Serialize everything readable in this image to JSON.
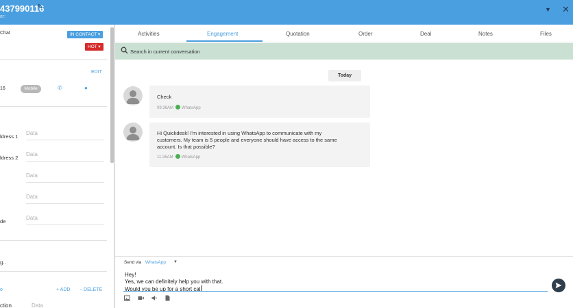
{
  "header": {
    "title": "437990116",
    "subtitle": "er:"
  },
  "left_panel": {
    "chat_label": "Chat",
    "contact_status": "IN CONTACT ▾",
    "temperature": "HOT ▾",
    "edit_label": "EDIT",
    "phone_fragment": "16",
    "phone_type": "Mobile",
    "fields": [
      {
        "label": "ldress 1",
        "value": "Data"
      },
      {
        "label": "ldress 2",
        "value": "Data"
      },
      {
        "label": "",
        "value": "Data"
      },
      {
        "label": "",
        "value": "Data"
      },
      {
        "label": "de",
        "value": "Data"
      }
    ],
    "note": "g..",
    "bottom_link": "o",
    "add_label": "+ ADD",
    "delete_label": "− DELETE",
    "bottom_field_label": "ction",
    "bottom_field_value": "Data"
  },
  "tabs": [
    {
      "label": "Activities",
      "active": false
    },
    {
      "label": "Engagement",
      "active": true
    },
    {
      "label": "Quotation",
      "active": false
    },
    {
      "label": "Order",
      "active": false
    },
    {
      "label": "Deal",
      "active": false
    },
    {
      "label": "Notes",
      "active": false
    },
    {
      "label": "Files",
      "active": false
    }
  ],
  "search": {
    "placeholder": "Search in current conversation"
  },
  "conversation": {
    "date_label": "Today",
    "messages": [
      {
        "lines": [
          "Check"
        ],
        "time": "09:36AM",
        "channel": "WhatsApp"
      },
      {
        "lines": [
          "Hi Quickdesk! I'm interested in using WhatsApp to communicate with my",
          "customers. My team is 5 people and everyone should have access to the same",
          "account. Is that possible?"
        ],
        "time": "11:26AM",
        "channel": "WhatsApp"
      }
    ]
  },
  "composer": {
    "send_via_label": "Send via",
    "channel": "WhatsApp",
    "draft_lines": [
      "Hey!",
      "Yes, we can definitely help you with that.",
      "Would you be up for a short cal"
    ]
  },
  "colors": {
    "header_blue": "#4a9fe0",
    "accent": "#4a9fe0",
    "hot_red": "#d62b2b",
    "search_bar": "#c9e0d3",
    "whatsapp_green": "#4caf50",
    "send_button": "#2f3e4d"
  },
  "icons": {
    "edit": "pencil-icon",
    "dropdown": "caret-down-icon",
    "close": "close-icon",
    "phone": "phone-icon",
    "chat": "chat-bubble-icon",
    "search": "search-icon",
    "send": "send-icon",
    "toolbar": [
      "image-icon",
      "video-icon",
      "audio-icon",
      "document-icon"
    ]
  }
}
